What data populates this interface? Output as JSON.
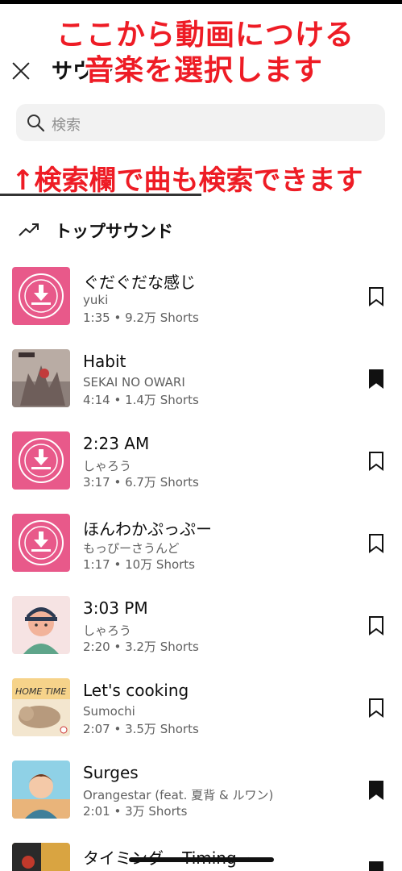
{
  "overlay": {
    "line1": "ここから動画につける",
    "line2": "音楽を選択します",
    "line3": "↑検索欄で曲も検索できます"
  },
  "header": {
    "title": "サウンド"
  },
  "search": {
    "placeholder": "検索"
  },
  "section": {
    "title": "トップサウンド"
  },
  "tracks": [
    {
      "title": "ぐだぐだな感じ",
      "artist": "yuki",
      "meta": "1:35 • 9.2万 Shorts",
      "saved": false,
      "art": "pink-free-bgm"
    },
    {
      "title": "Habit",
      "artist": "SEKAI NO OWARI",
      "meta": "4:14 • 1.4万 Shorts",
      "saved": true,
      "art": "habit-cover"
    },
    {
      "title": "2:23 AM",
      "artist": "しゃろう",
      "meta": "3:17 • 6.7万 Shorts",
      "saved": false,
      "art": "pink-free-bgm"
    },
    {
      "title": "ほんわかぷっぷー",
      "artist": "もっぴーさうんど",
      "meta": "1:17 • 10万 Shorts",
      "saved": false,
      "art": "pink-free-bgm"
    },
    {
      "title": "3:03 PM",
      "artist": "しゃろう",
      "meta": "2:20 • 3.2万 Shorts",
      "saved": false,
      "art": "girl-illustration"
    },
    {
      "title": "Let's cooking",
      "artist": "Sumochi",
      "meta": "2:07 • 3.5万 Shorts",
      "saved": false,
      "art": "home-time-cat"
    },
    {
      "title": "Surges",
      "artist": "Orangestar (feat. 夏背 & ルワン)",
      "meta": "2:01 • 3万 Shorts",
      "saved": true,
      "art": "surges-cover"
    },
    {
      "title": "タイミング ~Timing~",
      "artist": "",
      "meta": "",
      "saved": true,
      "art": "timing-cover"
    }
  ],
  "colors": {
    "overlay_red": "#ee1c25",
    "badge_pink": "#e8598a"
  }
}
